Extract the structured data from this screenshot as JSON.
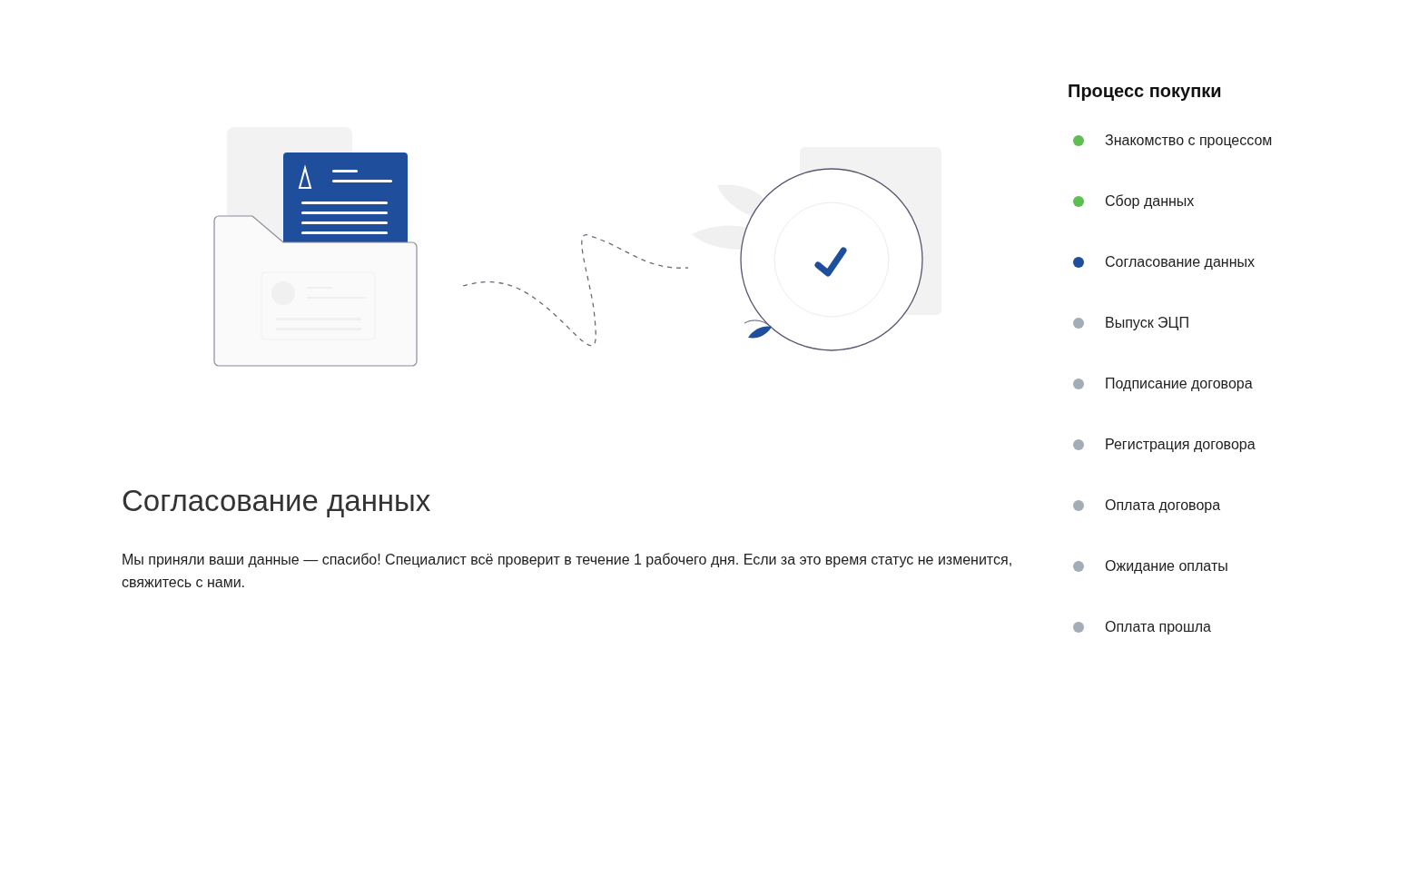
{
  "main": {
    "title": "Согласование данных",
    "description": "Мы приняли ваши данные — спасибо! Специалист всё проверит в течение 1 рабочего дня. Если за это время статус не изменится, свяжитесь с нами."
  },
  "sidebar": {
    "title": "Процесс покупки",
    "steps": [
      {
        "label": "Знакомство с процессом",
        "color": "#5cbf4f"
      },
      {
        "label": "Сбор данных",
        "color": "#5cbf4f"
      },
      {
        "label": "Согласование данных",
        "color": "#1f4f9c"
      },
      {
        "label": "Выпуск ЭЦП",
        "color": "#a3adb8"
      },
      {
        "label": "Подписание договора",
        "color": "#a3adb8"
      },
      {
        "label": "Регистрация договора",
        "color": "#a3adb8"
      },
      {
        "label": "Оплата договора",
        "color": "#a3adb8"
      },
      {
        "label": "Ожидание оплаты",
        "color": "#a3adb8"
      },
      {
        "label": "Оплата прошла",
        "color": "#a3adb8"
      }
    ]
  }
}
